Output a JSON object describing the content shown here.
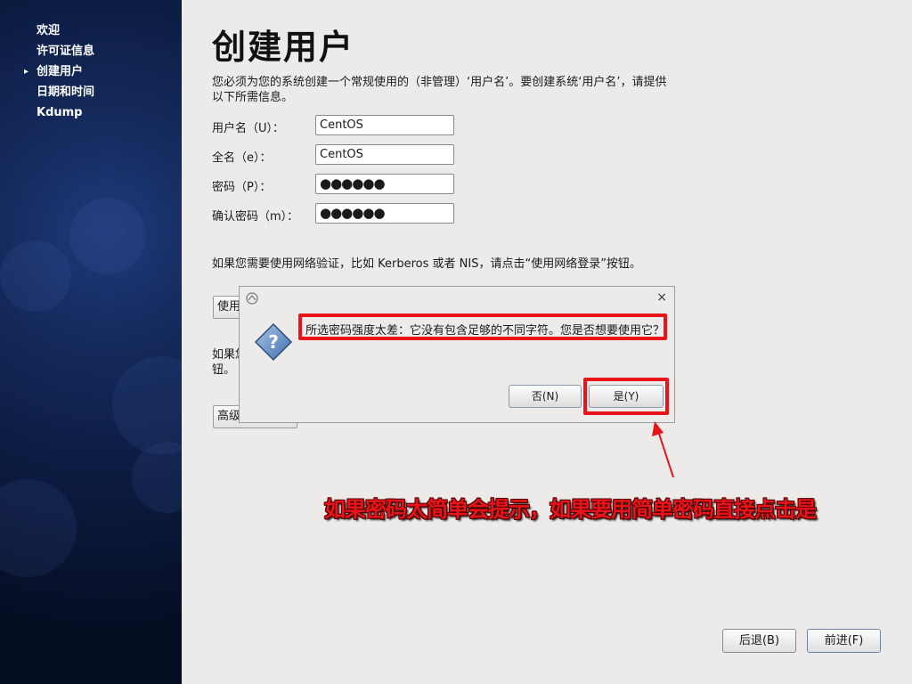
{
  "sidebar": {
    "items": [
      {
        "label": "欢迎",
        "active": false
      },
      {
        "label": "许可证信息",
        "active": false
      },
      {
        "label": "创建用户",
        "active": true
      },
      {
        "label": "日期和时间",
        "active": false
      },
      {
        "label": "Kdump",
        "active": false
      }
    ],
    "active_indicator": "▸"
  },
  "main": {
    "title": "创建用户",
    "description": "您必须为您的系统创建一个常规使用的（非管理）‘用户名’。要创建系统‘用户名’，请提供以下所需信息。",
    "fields": {
      "username": {
        "label": "用户名（U）：",
        "value": "CentOS"
      },
      "fullname": {
        "label": "全名（e）：",
        "value": "CentOS"
      },
      "password": {
        "label": "密码（P）：",
        "value": "●●●●●●"
      },
      "confirm": {
        "label": "确认密码（m）：",
        "value": "●●●●●●"
      }
    },
    "network_hint": "如果您需要使用网络验证，比如 Kerberos 或者 NIS，请点击“使用网络登录”按钮。",
    "network_button_partial": "使用",
    "advanced_text_partial": "如果您 钮。",
    "advanced_button_partial": "高级"
  },
  "dialog": {
    "icon": "question-diamond-icon",
    "close": "×",
    "message": "所选密码强度太差：它没有包含足够的不同字符。您是否想要使用它？",
    "no_label": "否(N)",
    "yes_label": "是(Y)"
  },
  "annotation": {
    "text": "如果密码太简单会提示，如果要用简单密码直接点击是",
    "color": "#e8141a"
  },
  "footer": {
    "back_label": "后退(B)",
    "next_label": "前进(F)"
  }
}
